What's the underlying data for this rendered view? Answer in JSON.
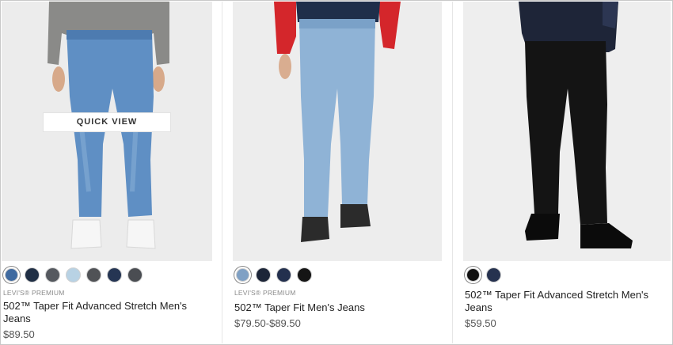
{
  "quick_view_label": "QUICK VIEW",
  "products": [
    {
      "brand": "LEVI'S® PREMIUM",
      "name": "502™ Taper Fit Advanced Stretch Men's Jeans",
      "price": "$89.50",
      "swatches": [
        "#3f6aa0",
        "#1f2e44",
        "#55595f",
        "#b8d2e4",
        "#505256",
        "#253553",
        "#4a4d52"
      ],
      "selected_swatch": 0
    },
    {
      "brand": "LEVI'S® PREMIUM",
      "name": "502™ Taper Fit Men's Jeans",
      "price": "$79.50-$89.50",
      "swatches": [
        "#7fa0c4",
        "#1c2538",
        "#23304e",
        "#151515"
      ],
      "selected_swatch": 0
    },
    {
      "brand": "",
      "name": "502™ Taper Fit Advanced Stretch Men's Jeans",
      "price": "$59.50",
      "swatches": [
        "#111111",
        "#26324f"
      ],
      "selected_swatch": 0
    }
  ]
}
